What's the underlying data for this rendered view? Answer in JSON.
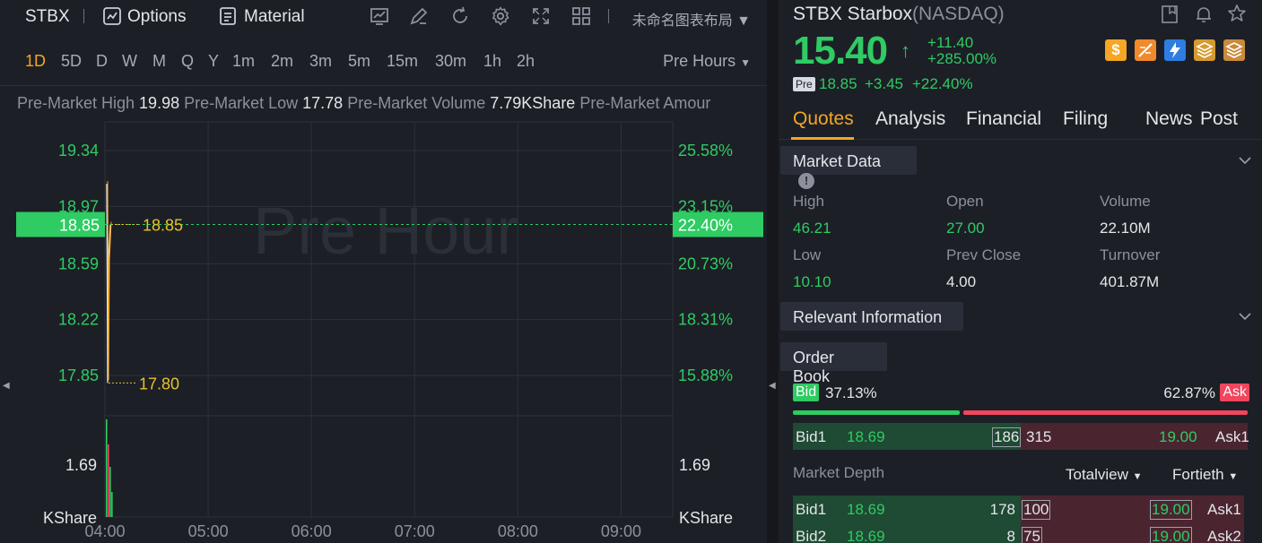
{
  "toolbar": {
    "symbol": "STBX",
    "options_label": "Options",
    "material_label": "Material",
    "layout_label": "未命名图表布局"
  },
  "intervals": [
    "1D",
    "5D",
    "D",
    "W",
    "M",
    "Q",
    "Y",
    "1m",
    "2m",
    "3m",
    "5m",
    "15m",
    "30m",
    "1h",
    "2h"
  ],
  "active_interval": "1D",
  "session_label": "Pre Hours",
  "premarket_stats": [
    {
      "label": "Pre-Market High",
      "value": "19.98"
    },
    {
      "label": "Pre-Market Low",
      "value": "17.78"
    },
    {
      "label": "Pre-Market Volume",
      "value": "7.79KShare"
    },
    {
      "label": "Pre-Market Amour",
      "value": ""
    }
  ],
  "chart_data": {
    "type": "line",
    "watermark": "Pre Hour",
    "x_ticks": [
      "04:00",
      "05:00",
      "06:00",
      "07:00",
      "08:00",
      "09:00"
    ],
    "y_ticks_left": [
      "19.34",
      "18.97",
      "18.59",
      "18.22",
      "17.85"
    ],
    "y_ticks_right": [
      "25.58%",
      "23.15%",
      "20.73%",
      "18.31%",
      "15.88%"
    ],
    "current_price_label": "18.85",
    "current_change_label": "22.40%",
    "current_price": 18.85,
    "marked_high": 18.85,
    "marked_low": 17.8,
    "marked_high_label": "18.85",
    "marked_low_label": "17.80",
    "price_series": [
      {
        "time": "04:00",
        "price": 19.12
      },
      {
        "time": "04:01",
        "price": 18.55
      },
      {
        "time": "04:02",
        "price": 17.8
      },
      {
        "time": "04:03",
        "price": 18.6
      },
      {
        "time": "04:04",
        "price": 18.85
      }
    ],
    "volume_axis_label": "1.69",
    "volume_unit": "KShare",
    "ylim": [
      17.66,
      19.53
    ]
  },
  "quote": {
    "name": "STBX Starbox",
    "exchange": "(NASDAQ)",
    "price": "15.40",
    "change": "+11.40",
    "change_pct": "+285.00%",
    "pre_badge": "Pre",
    "pre_price": "18.85",
    "pre_change": "+3.45",
    "pre_change_pct": "+22.40%"
  },
  "badges": [
    "dollar-badge",
    "slash-badge",
    "flash-badge",
    "stack-a-badge",
    "stack-t-badge"
  ],
  "tabs": [
    "Quotes",
    "Analysis",
    "Financial",
    "Filing",
    "News",
    "Post"
  ],
  "active_tab": "Quotes",
  "market_data": {
    "title": "Market Data",
    "fields": [
      {
        "label": "High",
        "value": "46.21",
        "color": "green"
      },
      {
        "label": "Open",
        "value": "27.00",
        "color": "green"
      },
      {
        "label": "Volume",
        "value": "22.10M",
        "color": "white"
      },
      {
        "label": "Low",
        "value": "10.10",
        "color": "green"
      },
      {
        "label": "Prev Close",
        "value": "4.00",
        "color": "white"
      },
      {
        "label": "Turnover",
        "value": "401.87M",
        "color": "white"
      }
    ]
  },
  "relevant_info": {
    "title": "Relevant Information"
  },
  "order_book": {
    "title": "Order Book",
    "bid_label": "Bid",
    "ask_label": "Ask",
    "bid_pct": "37.13%",
    "ask_pct": "62.87%",
    "bid_ratio": 0.3713,
    "row": {
      "bid_name": "Bid1",
      "bid_price": "18.69",
      "bid_size": "186",
      "ask_size": "315",
      "ask_price": "19.00",
      "ask_name": "Ask1"
    }
  },
  "market_depth": {
    "title": "Market Depth",
    "source": "Totalview",
    "levels": "Fortieth",
    "rows": [
      {
        "bid_name": "Bid1",
        "bid_price": "18.69",
        "bid_size": "178",
        "ask_size": "100",
        "ask_price": "19.00",
        "ask_name": "Ask1"
      },
      {
        "bid_name": "Bid2",
        "bid_price": "18.69",
        "bid_size": "8",
        "ask_size": "75",
        "ask_price": "19.00",
        "ask_name": "Ask2"
      }
    ]
  },
  "colors": {
    "up": "#2fcb63",
    "down": "#f2455e",
    "accent": "#f5a623",
    "background": "#1c1f26"
  }
}
